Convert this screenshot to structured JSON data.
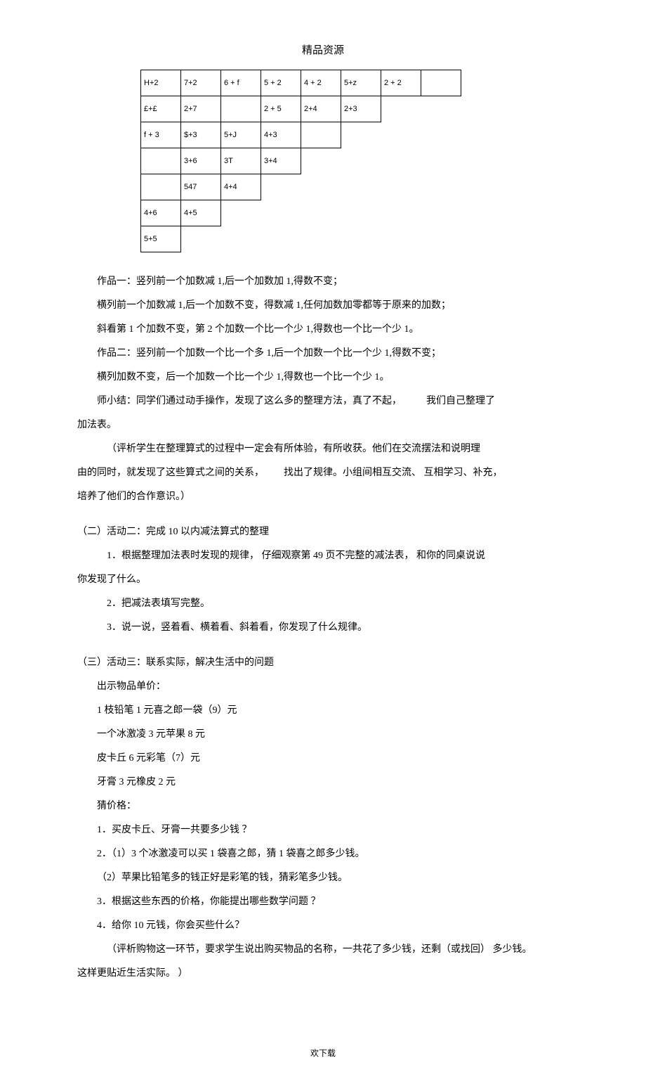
{
  "header": "精品资源",
  "table": {
    "rows": [
      [
        "H+2",
        "7+2",
        "6 + f",
        "5 + 2",
        "4 + 2",
        "5+z",
        "2 + 2",
        ""
      ],
      [
        "£+£",
        "2+7",
        "",
        "2 + 5",
        "2+4",
        "2+3",
        "",
        ""
      ],
      [
        "f + 3",
        "$+3",
        "5+J",
        "4+3",
        "",
        "",
        "",
        ""
      ],
      [
        "",
        "3+6",
        "3T",
        "3+4",
        "",
        "",
        "",
        ""
      ],
      [
        "",
        "547",
        "4+4",
        "",
        "",
        "",
        "",
        ""
      ],
      [
        "4+6",
        "4+5",
        "",
        "",
        "",
        "",
        "",
        ""
      ],
      [
        "5+5",
        "",
        "",
        "",
        "",
        "",
        "",
        ""
      ]
    ],
    "cutoffs": [
      8,
      6,
      5,
      4,
      3,
      2,
      1
    ]
  },
  "lines": {
    "l1": "作品一：竖列前一个加数减     1,后一个加数加 1,得数不变；",
    "l2": "横列前一个加数减 1,后一个加数不变，得数减        1,任何加数加零都等于原来的加数；",
    "l3": "斜看第 1 个加数不变，第  2 个加数一个比一个少  1,得数也一个比一个少  1。",
    "l4": "作品二：竖列前一个加数一个比一个多     1,后一个加数一个比一个少  1,得数不变；",
    "l5": "横列加数不变，后一个加数一个比一个少        1,得数也一个比一个少  1。",
    "l6a": "师小结：同学们通过动手操作，发现了这么多的整理方法，真了不起，",
    "l6b": "我们自己整理了",
    "l7": "加法表。",
    "l8": "（评析学生在整理算式的过程中一定会有所体验，有所收获。他们在交流摆法和说明理",
    "l9a": "由的同时，就发现了这些算式之间的关系，",
    "l9b": "找出了规律。小组间相互交流、 互相学习、补充，",
    "l10": "培养了他们的合作意识。）",
    "s2h": "（二）活动二：完成 10 以内减法算式的整理",
    "s2_1a": "1．根据整理加法表时发现的规律，   仔细观察第 49 页不完整的减法表，  和你的同桌说说",
    "s2_1b": "你发现了什么。",
    "s2_2": "2．把减法表填写完整。",
    "s2_3": "3．说一说，竖着看、横着看、斜着看，你发现了什么规律。",
    "s3h": "（三）活动三：联系实际，解决生活中的问题",
    "s3_1": "出示物品单价：",
    "s3_2": "1 枝铅笔 1 元喜之郎一袋（9）元",
    "s3_3": "一个冰激凌 3 元苹果 8 元",
    "s3_4": "皮卡丘 6 元彩笔（7）元",
    "s3_5": "牙膏 3 元橡皮 2 元",
    "s3_6": "猜价格：",
    "s3_7": "1．买皮卡丘、牙膏一共要多少钱     ？",
    "s3_8": "2．（1）3 个冰激凌可以买 1 袋喜之郎，猜 1 袋喜之郎多少钱。",
    "s3_9": "（2）苹果比铅笔多的钱正好是彩笔的钱，猜彩笔多少钱。",
    "s3_10": "3．根据这些东西的价格，你能提出哪些数学问题     ？",
    "s3_11": "4．给你 10 元钱，你会买些什么？",
    "s3_12a": "（评析购物这一环节，要求学生说出购买物品的名称，一共花了多少钱，还剩（或找回） 多少钱。",
    "s3_12b": "这样更贴近生活实际。                ）"
  },
  "footer": "欢下载"
}
